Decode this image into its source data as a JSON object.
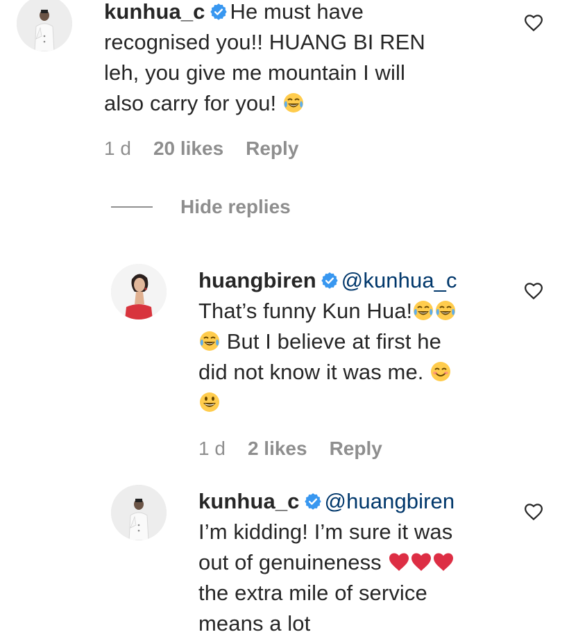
{
  "comments": [
    {
      "username": "kunhua_c",
      "mention": "",
      "lines": [
        "He must have",
        "recognised you!! HUANG BI REN",
        "leh, you give me mountain I will",
        "also carry for you!"
      ],
      "time": "1 d",
      "likes": "20 likes",
      "reply": "Reply",
      "emoji": "face-with-tears-of-joy"
    },
    {
      "username": "huangbiren",
      "mention": "@kunhua_c",
      "lines": [
        "That’s funny Kun Hua!",
        "But I believe at first he",
        "did not know it was me."
      ],
      "time": "1 d",
      "likes": "2 likes",
      "reply": "Reply",
      "emoji": "face-with-tears-of-joy"
    },
    {
      "username": "kunhua_c",
      "mention": "@huangbiren",
      "lines": [
        "I’m kidding! I’m sure it was",
        "out of genuineness",
        "the extra mile of service",
        "means a lot"
      ],
      "emoji": "red-heart"
    }
  ],
  "hide_replies": "Hide replies",
  "colors": {
    "text": "#262626",
    "muted": "#8e8e8e",
    "mention": "#00376b",
    "verified": "#3897f0",
    "heart": "#ed4956"
  }
}
